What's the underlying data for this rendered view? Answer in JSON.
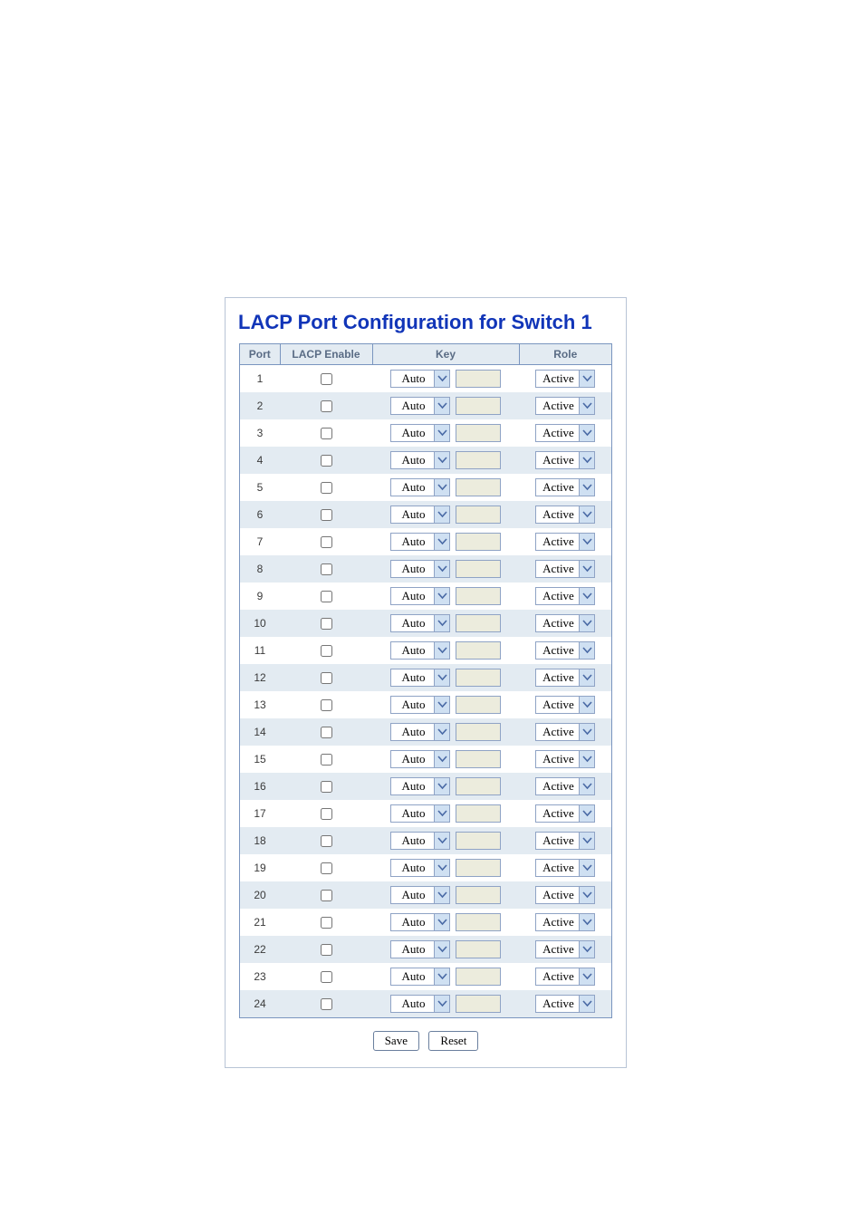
{
  "title": "LACP Port Configuration for Switch 1",
  "columns": {
    "port": "Port",
    "lacp_enable": "LACP Enable",
    "key": "Key",
    "role": "Role"
  },
  "rows": [
    {
      "port": "1",
      "enable": false,
      "key": "Auto",
      "role": "Active"
    },
    {
      "port": "2",
      "enable": false,
      "key": "Auto",
      "role": "Active"
    },
    {
      "port": "3",
      "enable": false,
      "key": "Auto",
      "role": "Active"
    },
    {
      "port": "4",
      "enable": false,
      "key": "Auto",
      "role": "Active"
    },
    {
      "port": "5",
      "enable": false,
      "key": "Auto",
      "role": "Active"
    },
    {
      "port": "6",
      "enable": false,
      "key": "Auto",
      "role": "Active"
    },
    {
      "port": "7",
      "enable": false,
      "key": "Auto",
      "role": "Active"
    },
    {
      "port": "8",
      "enable": false,
      "key": "Auto",
      "role": "Active"
    },
    {
      "port": "9",
      "enable": false,
      "key": "Auto",
      "role": "Active"
    },
    {
      "port": "10",
      "enable": false,
      "key": "Auto",
      "role": "Active"
    },
    {
      "port": "11",
      "enable": false,
      "key": "Auto",
      "role": "Active"
    },
    {
      "port": "12",
      "enable": false,
      "key": "Auto",
      "role": "Active"
    },
    {
      "port": "13",
      "enable": false,
      "key": "Auto",
      "role": "Active"
    },
    {
      "port": "14",
      "enable": false,
      "key": "Auto",
      "role": "Active"
    },
    {
      "port": "15",
      "enable": false,
      "key": "Auto",
      "role": "Active"
    },
    {
      "port": "16",
      "enable": false,
      "key": "Auto",
      "role": "Active"
    },
    {
      "port": "17",
      "enable": false,
      "key": "Auto",
      "role": "Active"
    },
    {
      "port": "18",
      "enable": false,
      "key": "Auto",
      "role": "Active"
    },
    {
      "port": "19",
      "enable": false,
      "key": "Auto",
      "role": "Active"
    },
    {
      "port": "20",
      "enable": false,
      "key": "Auto",
      "role": "Active"
    },
    {
      "port": "21",
      "enable": false,
      "key": "Auto",
      "role": "Active"
    },
    {
      "port": "22",
      "enable": false,
      "key": "Auto",
      "role": "Active"
    },
    {
      "port": "23",
      "enable": false,
      "key": "Auto",
      "role": "Active"
    },
    {
      "port": "24",
      "enable": false,
      "key": "Auto",
      "role": "Active"
    }
  ],
  "buttons": {
    "save": "Save",
    "reset": "Reset"
  }
}
